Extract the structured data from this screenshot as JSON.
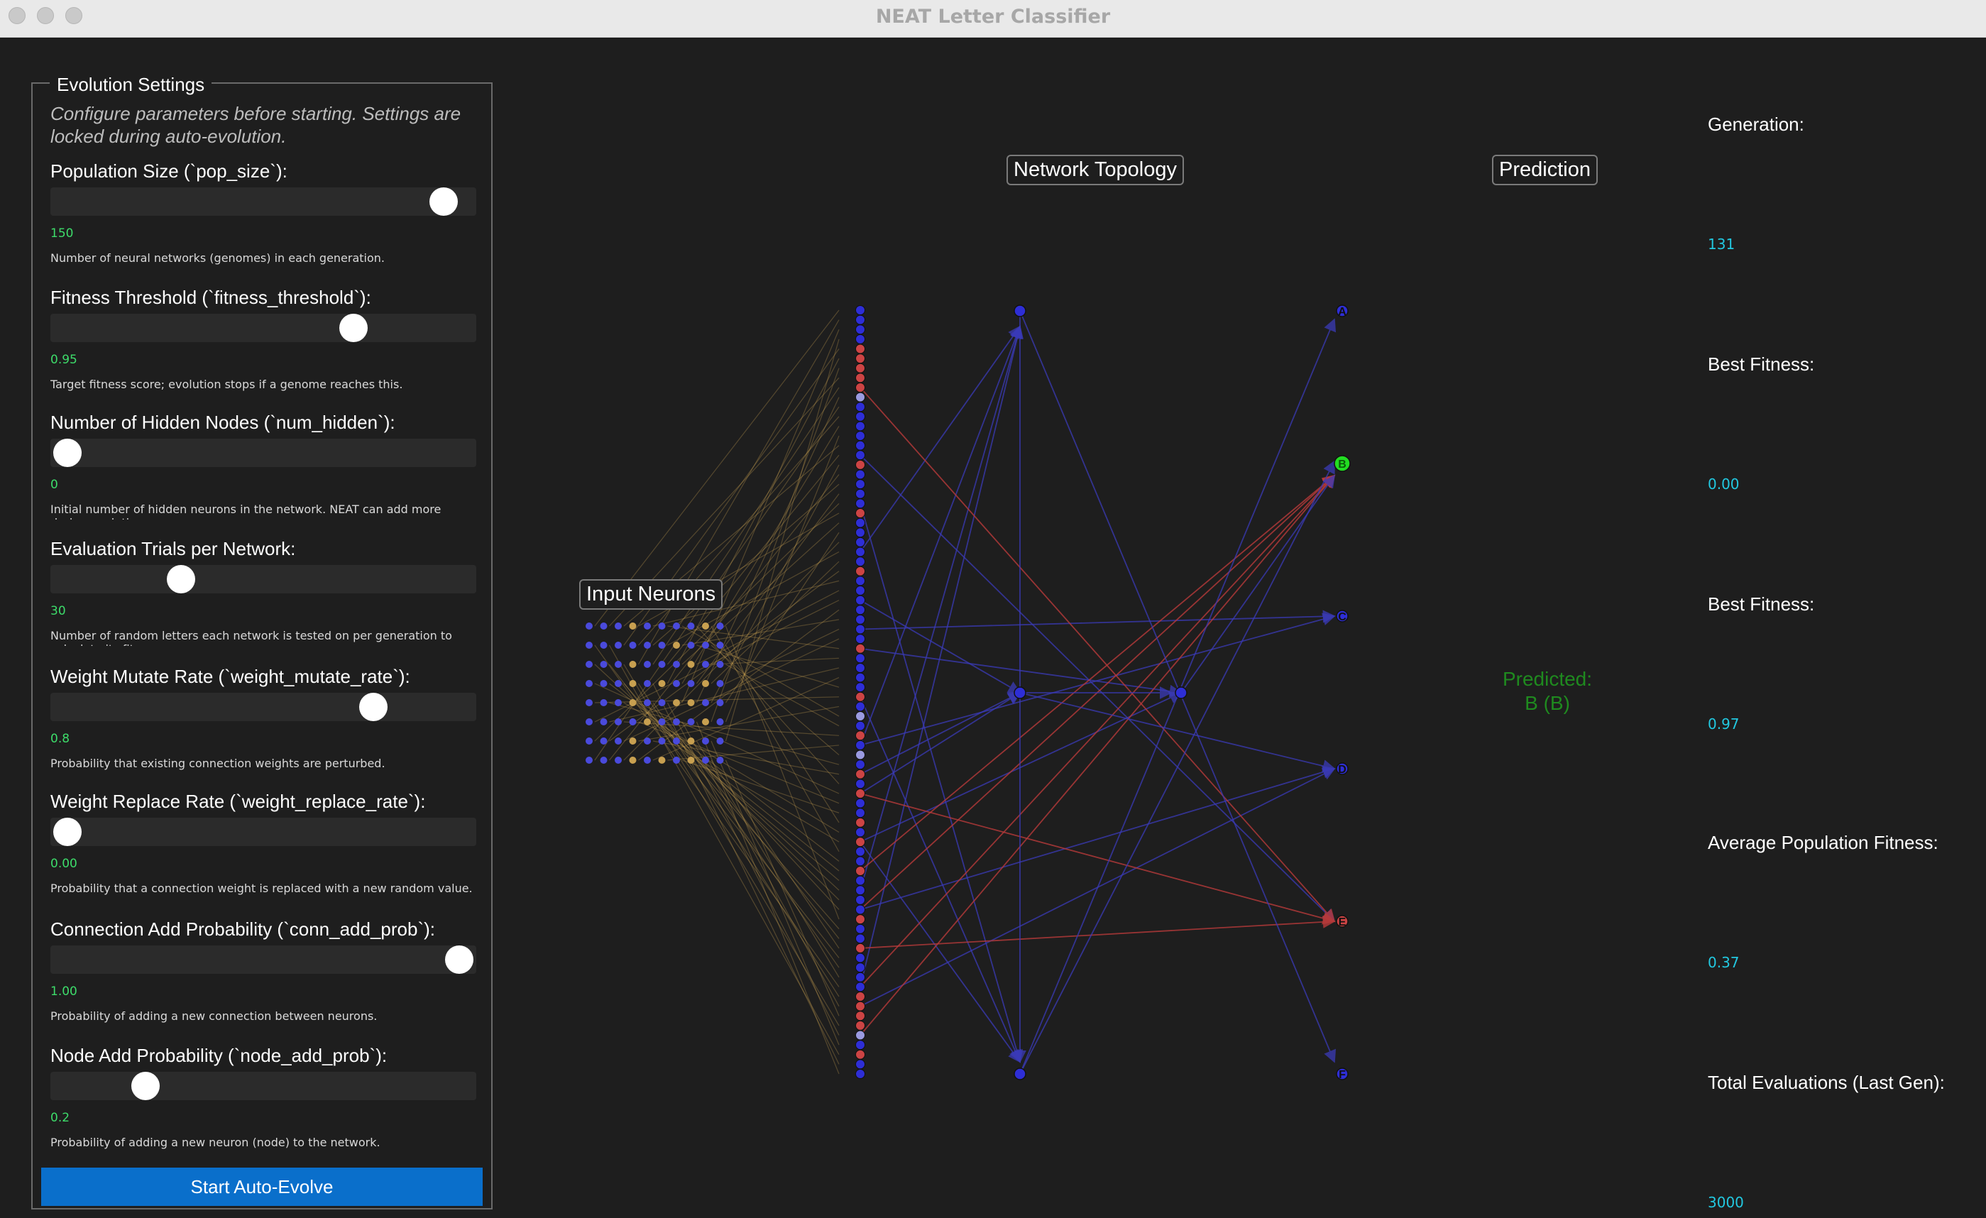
{
  "window": {
    "title": "NEAT Letter Classifier"
  },
  "settings": {
    "legend": "Evolution Settings",
    "intro": "Configure parameters before starting. Settings are locked during auto-evolution.",
    "params": [
      {
        "label": "Population Size (`pop_size`):",
        "value": "150",
        "level": 0.96,
        "description": "Number of neural networks (genomes) in each generation."
      },
      {
        "label": "Fitness Threshold (`fitness_threshold`):",
        "value": "0.95",
        "level": 0.73,
        "description": "Target fitness score; evolution stops if a genome reaches this."
      },
      {
        "label": "Number of Hidden Nodes (`num_hidden`):",
        "value": "0",
        "level": 0.0,
        "description": "Initial number of hidden neurons in the network. NEAT can add more during evolution."
      },
      {
        "label": "Evaluation Trials per Network:",
        "value": "30",
        "level": 0.29,
        "description": "Number of random letters each network is tested on per generation to calculate its fitness."
      },
      {
        "label": "Weight Mutate Rate (`weight_mutate_rate`):",
        "value": "0.8",
        "level": 0.78,
        "description": "Probability that existing connection weights are perturbed."
      },
      {
        "label": "Weight Replace Rate (`weight_replace_rate`):",
        "value": "0.00",
        "level": 0.0,
        "description": "Probability that a connection weight is replaced with a new random value."
      },
      {
        "label": "Connection Add Probability (`conn_add_prob`):",
        "value": "1.00",
        "level": 1.0,
        "description": "Probability of adding a new connection between neurons."
      },
      {
        "label": "Node Add Probability (`node_add_prob`):",
        "value": "0.2",
        "level": 0.2,
        "description": "Probability of adding a new neuron (node) to the network."
      }
    ],
    "start_button": "Start Auto-Evolve"
  },
  "network": {
    "input_label": "Input Neurons",
    "topology_label": "Network Topology",
    "prediction_label": "Prediction",
    "predicted_line1": "Predicted:",
    "predicted_line2": "B (B)",
    "outputs": [
      "A",
      "B",
      "C",
      "D",
      "E",
      "F"
    ],
    "highlighted_output": "B",
    "colors": {
      "node": "#2e2ed6",
      "node_active": "#cc4444",
      "node_bright": "#9a9ae0",
      "edge_positive": "#3a3ab8",
      "edge_negative": "#b83a3a",
      "edge_input": "#c8a050",
      "highlight": "#22dd22"
    }
  },
  "stats": [
    {
      "label": "Generation:",
      "value": "131"
    },
    {
      "label": "Best Fitness:",
      "value": "0.00"
    },
    {
      "label": "Best Fitness:",
      "value": "0.97"
    },
    {
      "label": "Average Population Fitness:",
      "value": "0.37"
    },
    {
      "label": "Total Evaluations (Last Gen):",
      "value": "3000"
    }
  ]
}
